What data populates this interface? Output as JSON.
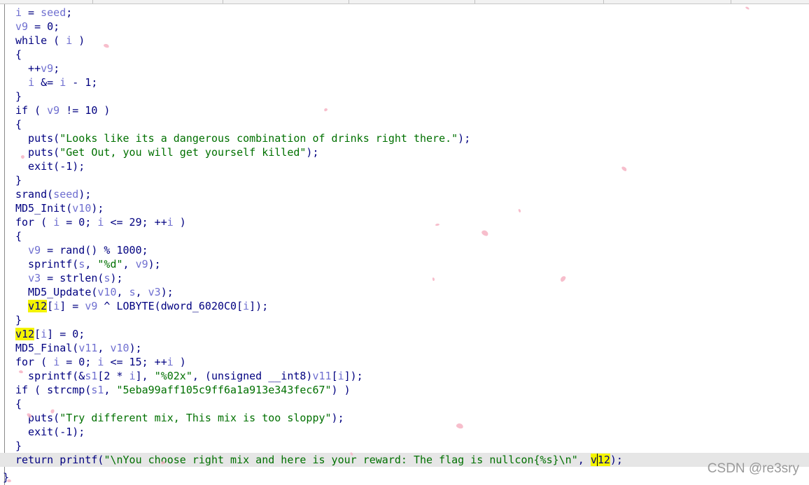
{
  "code_lines": [
    [
      {
        "t": "i",
        "c": "v"
      },
      {
        "t": " = ",
        "c": "p"
      },
      {
        "t": "seed",
        "c": "v"
      },
      {
        "t": ";",
        "c": "p"
      }
    ],
    [
      {
        "t": "v9",
        "c": "v"
      },
      {
        "t": " = 0;",
        "c": "p"
      }
    ],
    [
      {
        "t": "while ( ",
        "c": "p"
      },
      {
        "t": "i",
        "c": "v"
      },
      {
        "t": " )",
        "c": "p"
      }
    ],
    [
      {
        "t": "{",
        "c": "p"
      }
    ],
    [
      {
        "t": "  ++",
        "c": "p"
      },
      {
        "t": "v9",
        "c": "v"
      },
      {
        "t": ";",
        "c": "p"
      }
    ],
    [
      {
        "t": "  ",
        "c": "p"
      },
      {
        "t": "i",
        "c": "v"
      },
      {
        "t": " &= ",
        "c": "p"
      },
      {
        "t": "i",
        "c": "v"
      },
      {
        "t": " - 1;",
        "c": "p"
      }
    ],
    [
      {
        "t": "}",
        "c": "p"
      }
    ],
    [
      {
        "t": "if ( ",
        "c": "p"
      },
      {
        "t": "v9",
        "c": "v"
      },
      {
        "t": " != 10 )",
        "c": "p"
      }
    ],
    [
      {
        "t": "{",
        "c": "p"
      }
    ],
    [
      {
        "t": "  puts(",
        "c": "p"
      },
      {
        "t": "\"Looks like its a dangerous combination of drinks right there.\"",
        "c": "s"
      },
      {
        "t": ");",
        "c": "p"
      }
    ],
    [
      {
        "t": "  puts(",
        "c": "p"
      },
      {
        "t": "\"Get Out, you will get yourself killed\"",
        "c": "s"
      },
      {
        "t": ");",
        "c": "p"
      }
    ],
    [
      {
        "t": "  exit(-1);",
        "c": "p"
      }
    ],
    [
      {
        "t": "}",
        "c": "p"
      }
    ],
    [
      {
        "t": "srand(",
        "c": "p"
      },
      {
        "t": "seed",
        "c": "v"
      },
      {
        "t": ");",
        "c": "p"
      }
    ],
    [
      {
        "t": "MD5_Init(",
        "c": "p"
      },
      {
        "t": "v10",
        "c": "v"
      },
      {
        "t": ");",
        "c": "p"
      }
    ],
    [
      {
        "t": "for ( ",
        "c": "p"
      },
      {
        "t": "i",
        "c": "v"
      },
      {
        "t": " = 0; ",
        "c": "p"
      },
      {
        "t": "i",
        "c": "v"
      },
      {
        "t": " <= 29; ++",
        "c": "p"
      },
      {
        "t": "i",
        "c": "v"
      },
      {
        "t": " )",
        "c": "p"
      }
    ],
    [
      {
        "t": "{",
        "c": "p"
      }
    ],
    [
      {
        "t": "  ",
        "c": "p"
      },
      {
        "t": "v9",
        "c": "v"
      },
      {
        "t": " = rand() % 1000;",
        "c": "p"
      }
    ],
    [
      {
        "t": "  sprintf(",
        "c": "p"
      },
      {
        "t": "s",
        "c": "v"
      },
      {
        "t": ", ",
        "c": "p"
      },
      {
        "t": "\"%d\"",
        "c": "s"
      },
      {
        "t": ", ",
        "c": "p"
      },
      {
        "t": "v9",
        "c": "v"
      },
      {
        "t": ");",
        "c": "p"
      }
    ],
    [
      {
        "t": "  ",
        "c": "p"
      },
      {
        "t": "v3",
        "c": "v"
      },
      {
        "t": " = strlen(",
        "c": "p"
      },
      {
        "t": "s",
        "c": "v"
      },
      {
        "t": ");",
        "c": "p"
      }
    ],
    [
      {
        "t": "  MD5_Update(",
        "c": "p"
      },
      {
        "t": "v10",
        "c": "v"
      },
      {
        "t": ", ",
        "c": "p"
      },
      {
        "t": "s",
        "c": "v"
      },
      {
        "t": ", ",
        "c": "p"
      },
      {
        "t": "v3",
        "c": "v"
      },
      {
        "t": ");",
        "c": "p"
      }
    ],
    [
      {
        "t": "  ",
        "c": "p"
      },
      {
        "t": "v12",
        "c": "hl"
      },
      {
        "t": "[",
        "c": "p"
      },
      {
        "t": "i",
        "c": "v"
      },
      {
        "t": "] = ",
        "c": "p"
      },
      {
        "t": "v9",
        "c": "v"
      },
      {
        "t": " ^ LOBYTE(dword_6020C0[",
        "c": "p"
      },
      {
        "t": "i",
        "c": "v"
      },
      {
        "t": "]);",
        "c": "p"
      }
    ],
    [
      {
        "t": "}",
        "c": "p"
      }
    ],
    [
      {
        "t": "v12",
        "c": "hl"
      },
      {
        "t": "[",
        "c": "p"
      },
      {
        "t": "i",
        "c": "v"
      },
      {
        "t": "] = 0;",
        "c": "p"
      }
    ],
    [
      {
        "t": "MD5_Final(",
        "c": "p"
      },
      {
        "t": "v11",
        "c": "v"
      },
      {
        "t": ", ",
        "c": "p"
      },
      {
        "t": "v10",
        "c": "v"
      },
      {
        "t": ");",
        "c": "p"
      }
    ],
    [
      {
        "t": "for ( ",
        "c": "p"
      },
      {
        "t": "i",
        "c": "v"
      },
      {
        "t": " = 0; ",
        "c": "p"
      },
      {
        "t": "i",
        "c": "v"
      },
      {
        "t": " <= 15; ++",
        "c": "p"
      },
      {
        "t": "i",
        "c": "v"
      },
      {
        "t": " )",
        "c": "p"
      }
    ],
    [
      {
        "t": "  sprintf(&",
        "c": "p"
      },
      {
        "t": "s1",
        "c": "v"
      },
      {
        "t": "[2 * ",
        "c": "p"
      },
      {
        "t": "i",
        "c": "v"
      },
      {
        "t": "], ",
        "c": "p"
      },
      {
        "t": "\"%02x\"",
        "c": "s"
      },
      {
        "t": ", (unsigned __int8)",
        "c": "p"
      },
      {
        "t": "v11",
        "c": "v"
      },
      {
        "t": "[",
        "c": "p"
      },
      {
        "t": "i",
        "c": "v"
      },
      {
        "t": "]);",
        "c": "p"
      }
    ],
    [
      {
        "t": "if ( strcmp(",
        "c": "p"
      },
      {
        "t": "s1",
        "c": "v"
      },
      {
        "t": ", ",
        "c": "p"
      },
      {
        "t": "\"5eba99aff105c9ff6a1a913e343fec67\"",
        "c": "s"
      },
      {
        "t": ") )",
        "c": "p"
      }
    ],
    [
      {
        "t": "{",
        "c": "p"
      }
    ],
    [
      {
        "t": "  puts(",
        "c": "p"
      },
      {
        "t": "\"Try different mix, This mix is too sloppy\"",
        "c": "s"
      },
      {
        "t": ");",
        "c": "p"
      }
    ],
    [
      {
        "t": "  exit(-1);",
        "c": "p"
      }
    ],
    [
      {
        "t": "}",
        "c": "p"
      }
    ],
    [
      {
        "t": "return printf(",
        "c": "p"
      },
      {
        "t": "\"\\nYou choose right mix and here is your reward: The flag is nullcon{%s}\\n\"",
        "c": "s"
      },
      {
        "t": ", ",
        "c": "p"
      },
      {
        "t": "v12",
        "c": "hl",
        "caret": true
      },
      {
        "t": ");",
        "c": "p"
      }
    ]
  ],
  "closing_brace": "}",
  "watermark": "CSDN @re3sry",
  "colors": {
    "plain": "#000080",
    "variable": "#6f6fd0",
    "string": "#007000",
    "highlight": "#f4f400",
    "current_line": "#e6e6e6"
  }
}
